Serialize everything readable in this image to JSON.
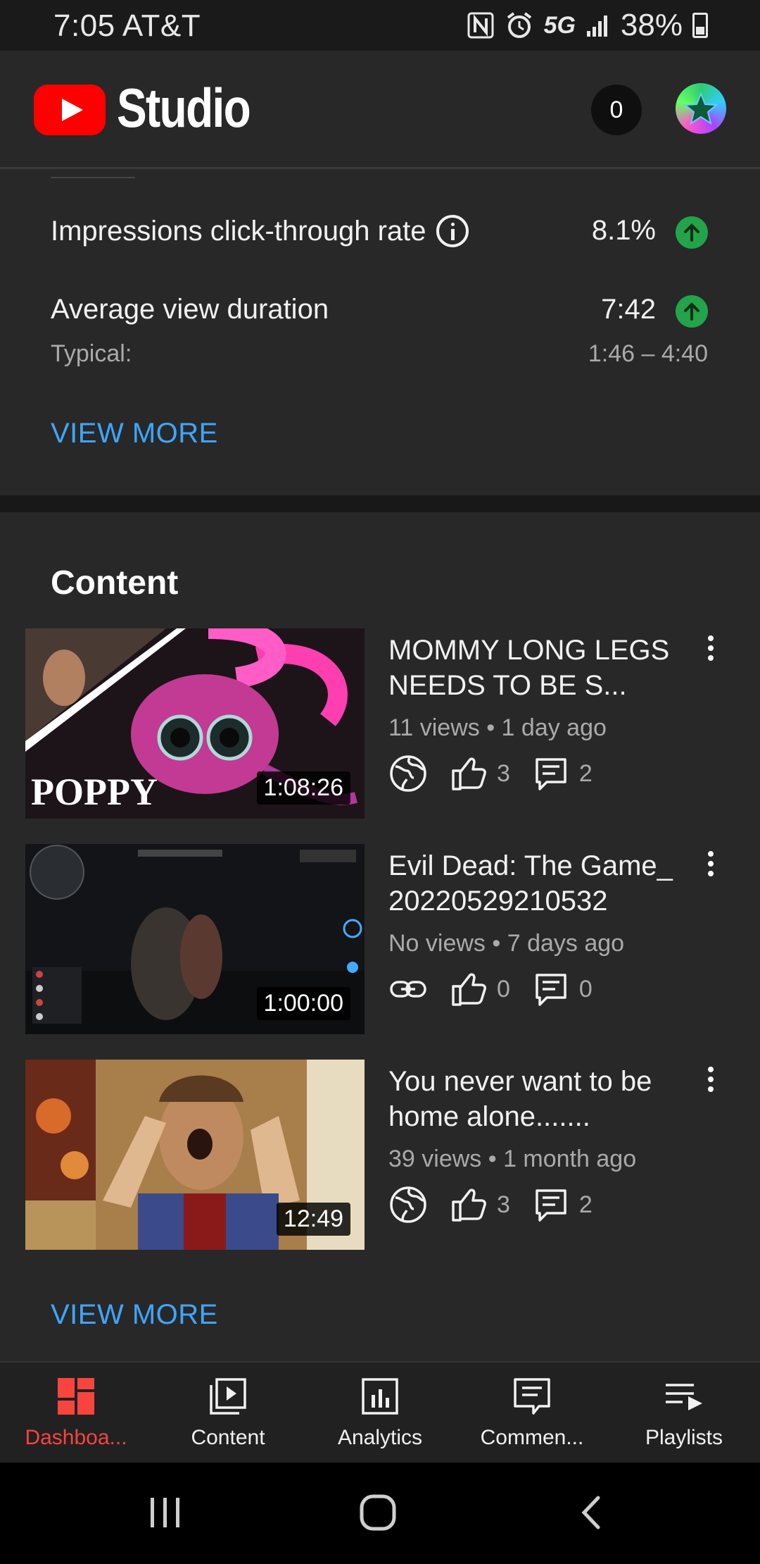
{
  "status_bar": {
    "time_carrier": "7:05 AT&T",
    "network": "5G",
    "battery": "38%"
  },
  "header": {
    "title": "Studio",
    "notification_count": "0"
  },
  "stats": {
    "ctr_label": "Impressions click-through rate",
    "ctr_value": "8.1%",
    "avd_label": "Average view duration",
    "avd_value": "7:42",
    "typical_label": "Typical:",
    "typical_value": "1:46 – 4:40",
    "view_more": "VIEW MORE",
    "trend_color": "#23a34a"
  },
  "content": {
    "title": "Content",
    "videos": [
      {
        "title": "MOMMY LONG LEGS NEEDS TO BE S...",
        "meta": "11 views • 1 day ago",
        "visibility_icon": "globe-icon",
        "likes": "3",
        "comments": "2",
        "duration": "1:08:26",
        "thumb_text": "POPPY"
      },
      {
        "title": "Evil Dead: The Game_20220529210532",
        "meta": "No views • 7 days ago",
        "visibility_icon": "link-icon",
        "likes": "0",
        "comments": "0",
        "duration": "1:00:00"
      },
      {
        "title": "You never want to be home alone.......",
        "meta": "39 views • 1 month ago",
        "visibility_icon": "globe-icon",
        "likes": "3",
        "comments": "2",
        "duration": "12:49"
      }
    ],
    "view_more": "VIEW MORE"
  },
  "bottom_nav": [
    {
      "label": "Dashboa...",
      "icon": "dashboard-icon",
      "active": true
    },
    {
      "label": "Content",
      "icon": "content-icon"
    },
    {
      "label": "Analytics",
      "icon": "analytics-icon"
    },
    {
      "label": "Commen...",
      "icon": "comments-icon"
    },
    {
      "label": "Playlists",
      "icon": "playlists-icon"
    }
  ],
  "colors": {
    "accent_blue": "#3ea6ff",
    "active_red": "#f8443e",
    "brand_red": "#ff0000"
  }
}
